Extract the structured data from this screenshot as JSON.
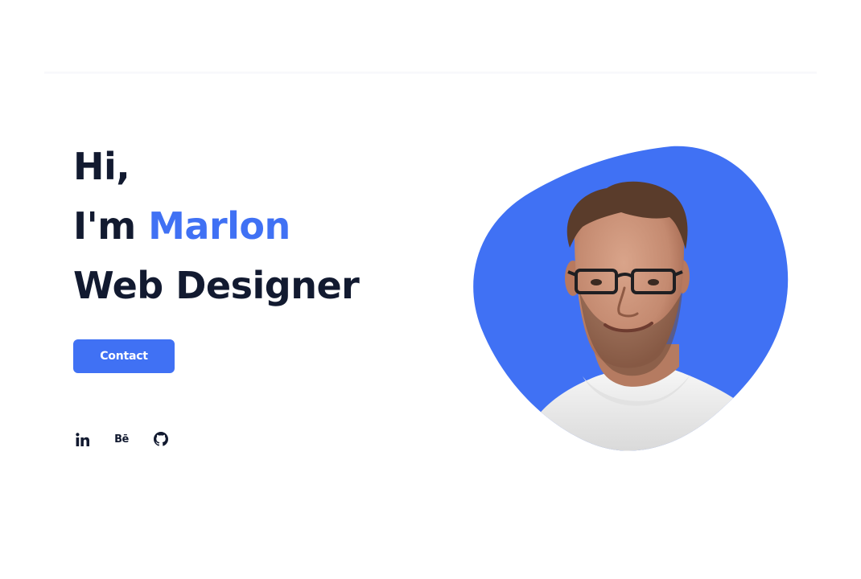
{
  "hero": {
    "greeting": "Hi,",
    "intro_prefix": "I'm ",
    "name": "Marlon",
    "role": "Web Designer"
  },
  "contact_button": {
    "label": "Contact"
  },
  "socials": [
    {
      "label": "in",
      "icon": "linkedin-icon"
    },
    {
      "label": "Bē",
      "icon": "behance-icon"
    },
    {
      "label": "",
      "icon": "github-icon"
    }
  ],
  "colors": {
    "accent": "#4071f4",
    "heading": "#121a30",
    "background": "#ffffff"
  }
}
